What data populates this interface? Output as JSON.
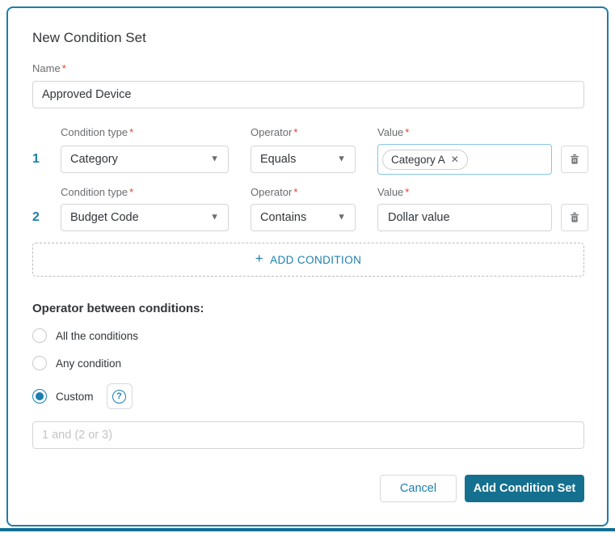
{
  "dialog": {
    "title": "New Condition Set",
    "required_marker": "*",
    "name_field": {
      "label": "Name",
      "value": "Approved Device"
    },
    "condition_columns": {
      "type_label": "Condition type",
      "operator_label": "Operator",
      "value_label": "Value"
    },
    "conditions": [
      {
        "index": "1",
        "type": "Category",
        "operator": "Equals",
        "value_chip": "Category A"
      },
      {
        "index": "2",
        "type": "Budget Code",
        "operator": "Contains",
        "value_text": "Dollar value"
      }
    ],
    "add_condition_label": "ADD CONDITION",
    "operator_section": {
      "heading": "Operator between conditions:",
      "options": [
        {
          "label": "All the conditions",
          "selected": false
        },
        {
          "label": "Any condition",
          "selected": false
        },
        {
          "label": "Custom",
          "selected": true
        }
      ],
      "custom_placeholder": "1 and (2 or 3)"
    },
    "footer": {
      "cancel_label": "Cancel",
      "submit_label": "Add Condition Set"
    }
  },
  "icons": {
    "dropdown_caret": "▼",
    "chip_remove": "✕",
    "add_plus": "+",
    "help": "?"
  },
  "colors": {
    "accent_blue": "#1d7fad",
    "primary_button": "#15708f",
    "card_border": "#1e7ca9",
    "required_red": "#e5402a",
    "focus_border": "#86c6e5"
  }
}
